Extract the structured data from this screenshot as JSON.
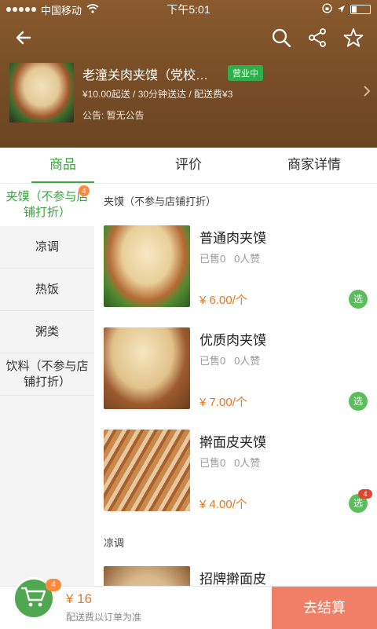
{
  "status_bar": {
    "carrier": "中国移动",
    "time": "下午5:01"
  },
  "shop": {
    "name": "老潼关肉夹馍（党校…",
    "status_badge": "营业中",
    "meta": "¥10.00起送 / 30分钟送达 / 配送费¥3",
    "notice": "公告: 暂无公告"
  },
  "tabs": [
    {
      "label": "商品"
    },
    {
      "label": "评价"
    },
    {
      "label": "商家详情"
    }
  ],
  "sidebar": {
    "items": [
      {
        "label": "夹馍（不参与店铺打折）",
        "badge": "4"
      },
      {
        "label": "凉调"
      },
      {
        "label": "热饭"
      },
      {
        "label": "粥类"
      },
      {
        "label": "饮料（不参与店铺打折）"
      }
    ]
  },
  "sections": [
    {
      "title": "夹馍（不参与店铺打折）",
      "products": [
        {
          "name": "普通肉夹馍",
          "sold": "已售0",
          "likes": "0人赞",
          "price": "¥ 6.00/个",
          "add_label": "选"
        },
        {
          "name": "优质肉夹馍",
          "sold": "已售0",
          "likes": "0人赞",
          "price": "¥ 7.00/个",
          "add_label": "选"
        },
        {
          "name": "擀面皮夹馍",
          "sold": "已售0",
          "likes": "0人赞",
          "price": "¥ 4.00/个",
          "add_label": "选",
          "badge": "4"
        }
      ]
    },
    {
      "title": "凉调",
      "products": [
        {
          "name": "招牌擀面皮"
        }
      ]
    }
  ],
  "cart": {
    "badge": "4",
    "total": "¥ 16",
    "note": "配送费以订单为准",
    "checkout_label": "去结算"
  },
  "colors": {
    "accent": "#3aa640",
    "price": "#e07a2a",
    "checkout": "#ef7f66",
    "header": "#7a4f28"
  }
}
